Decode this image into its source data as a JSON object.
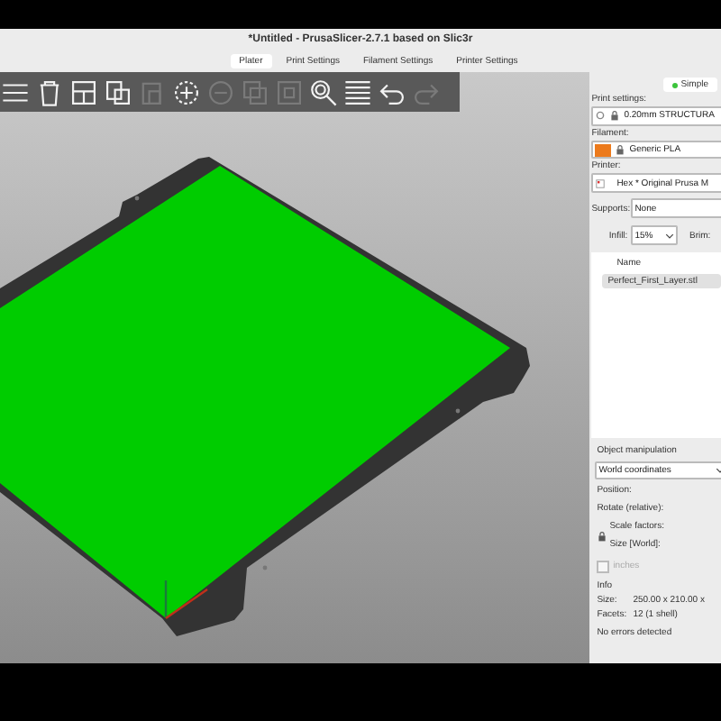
{
  "window": {
    "title": "*Untitled - PrusaSlicer-2.7.1 based on Slic3r"
  },
  "tabs": [
    {
      "label": "Plater",
      "selected": true
    },
    {
      "label": "Print Settings",
      "selected": false
    },
    {
      "label": "Filament Settings",
      "selected": false
    },
    {
      "label": "Printer Settings",
      "selected": false
    }
  ],
  "toolbar": [
    {
      "kind": "menu",
      "disabled": false
    },
    {
      "kind": "trash",
      "disabled": false
    },
    {
      "kind": "arrange",
      "disabled": false
    },
    {
      "kind": "copy",
      "disabled": false
    },
    {
      "kind": "paste",
      "disabled": true
    },
    {
      "kind": "add",
      "disabled": false
    },
    {
      "kind": "remove",
      "disabled": true
    },
    {
      "kind": "split-objects",
      "disabled": true
    },
    {
      "kind": "split-parts",
      "disabled": true
    },
    {
      "kind": "search",
      "disabled": false
    },
    {
      "kind": "layers",
      "disabled": false
    },
    {
      "kind": "undo",
      "disabled": false
    },
    {
      "kind": "redo",
      "disabled": true
    }
  ],
  "sidebar": {
    "mode": {
      "label": "Simple",
      "color": "#3cc43c"
    },
    "print_settings": {
      "label": "Print settings:",
      "value": "0.20mm STRUCTURA"
    },
    "filament": {
      "label": "Filament:",
      "value": "Generic PLA",
      "color": "#ec7a1c"
    },
    "printer": {
      "label": "Printer:",
      "value": "Hex * Original Prusa M"
    },
    "supports": {
      "label": "Supports:",
      "value": "None"
    },
    "infill": {
      "label": "Infill:",
      "value": "15%"
    },
    "brim": {
      "label": "Brim:"
    },
    "object_list": {
      "column": "Name",
      "items": [
        {
          "name": "Perfect_First_Layer.stl",
          "selected": true
        }
      ]
    },
    "object_manipulation": {
      "title": "Object manipulation",
      "coordinates": "World coordinates",
      "position": "Position:",
      "rotate": "Rotate (relative):",
      "scale": "Scale factors:",
      "size": "Size [World]:",
      "inches": {
        "label": "inches",
        "checked": false
      }
    },
    "info": {
      "title": "Info",
      "rows": [
        {
          "label": "Size:",
          "value": "250.00 x 210.00 x"
        },
        {
          "label": "Facets:",
          "value": "12 (1 shell)"
        }
      ],
      "status": "No errors detected"
    }
  }
}
